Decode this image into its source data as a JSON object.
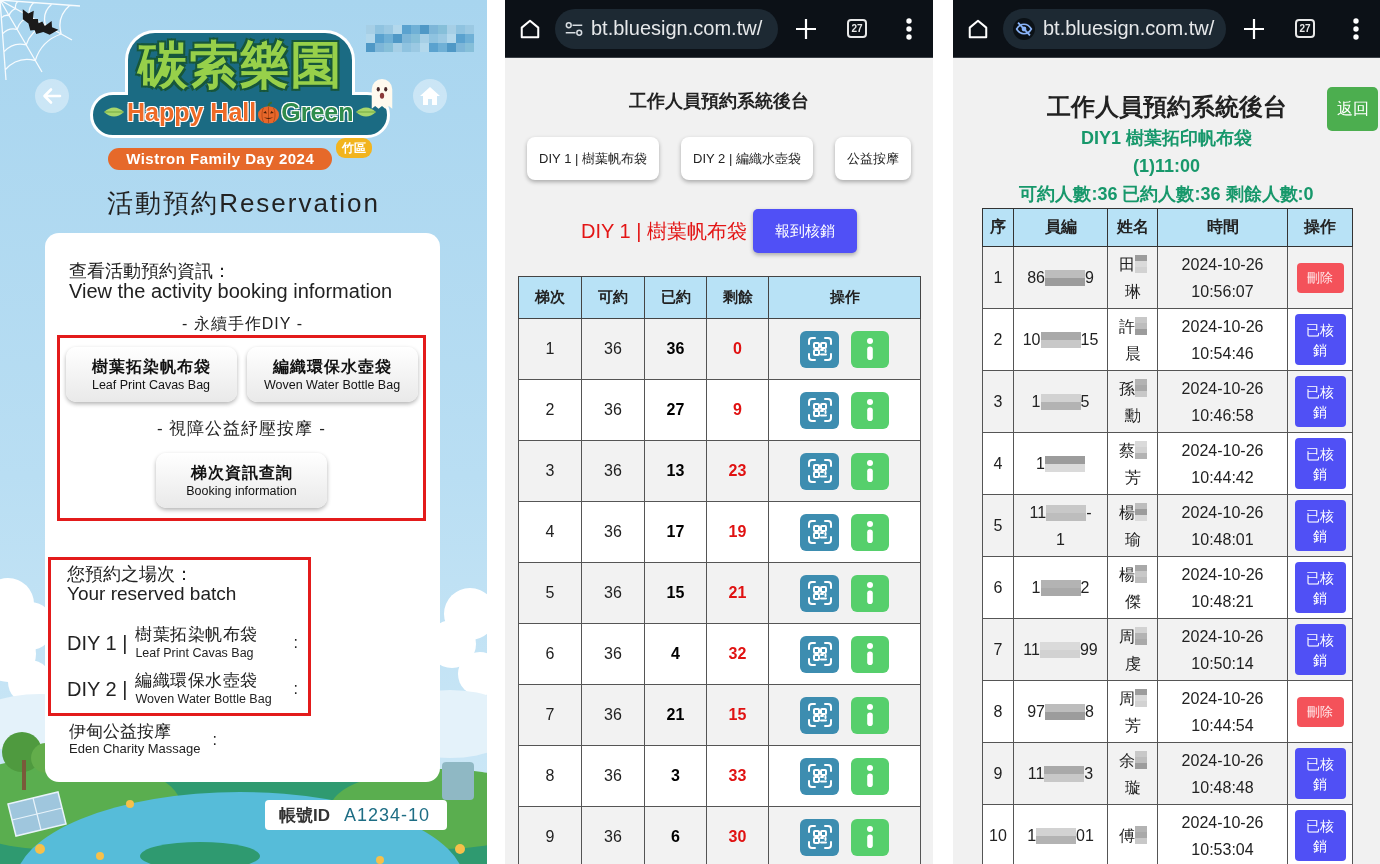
{
  "event_page": {
    "logo": {
      "title": "碳索樂園",
      "tagline_start": "Happy Hall",
      "tagline_end": "Green",
      "event": "Wistron Family Day 2024",
      "site": "竹區"
    },
    "title": "活動預約Reservation",
    "intro": [
      "查看活動預約資訊：",
      "View the activity booking information"
    ],
    "menu": {
      "heading": "- 永續手作DIY -",
      "highlighted": true,
      "groups": [
        {
          "buttons": [
            {
              "label": "樹葉拓染帆布袋",
              "sublabel": "Leaf Print Cavas Bag"
            },
            {
              "label": "編織環保水壺袋",
              "sublabel": "Woven Water Bottle Bag"
            }
          ]
        },
        {
          "heading": "- 視障公益紓壓按摩 -",
          "buttons": [
            {
              "label": "梯次資訊查詢",
              "sublabel": "Booking information"
            }
          ]
        }
      ]
    },
    "reserved": {
      "highlighted": true,
      "heading": [
        "您預約之場次：",
        "Your reserved batch"
      ],
      "items": [
        {
          "prefix": "DIY 1 |",
          "name": "樹葉拓染帆布袋",
          "name_en": "Leaf Print Cavas Bag",
          "value": ":"
        },
        {
          "prefix": "DIY 2 |",
          "name": "編織環保水壺袋",
          "name_en": "Woven Water Bottle Bag",
          "value": ":"
        }
      ]
    },
    "charity": {
      "name": "伊甸公益按摩",
      "name_en": "Eden Charity Massage",
      "value": ":"
    },
    "account": {
      "label": "帳號ID",
      "value": "A1234-10"
    }
  },
  "admin_page": {
    "browser": {
      "site_icon": {
        "kind": "tune"
      },
      "url": "bt.bluesign.com.tw/",
      "tab_count": "27"
    },
    "title": "工作人員預約系統後台",
    "activity_buttons": [
      "DIY 1 | 樹葉帆布袋",
      "DIY 2 | 編織水壺袋",
      "公益按摩"
    ],
    "heading": "DIY 1 | 樹葉帆布袋",
    "checkin_button": "報到核銷",
    "table": {
      "columns": [
        "梯次",
        "可約",
        "已約",
        "剩餘",
        "操作"
      ],
      "rows": [
        {
          "batch": "1",
          "capacity": "36",
          "booked": "36",
          "remaining": "0"
        },
        {
          "batch": "2",
          "capacity": "36",
          "booked": "27",
          "remaining": "9"
        },
        {
          "batch": "3",
          "capacity": "36",
          "booked": "13",
          "remaining": "23"
        },
        {
          "batch": "4",
          "capacity": "36",
          "booked": "17",
          "remaining": "19"
        },
        {
          "batch": "5",
          "capacity": "36",
          "booked": "15",
          "remaining": "21"
        },
        {
          "batch": "6",
          "capacity": "36",
          "booked": "4",
          "remaining": "32"
        },
        {
          "batch": "7",
          "capacity": "36",
          "booked": "21",
          "remaining": "15"
        },
        {
          "batch": "8",
          "capacity": "36",
          "booked": "3",
          "remaining": "33"
        },
        {
          "batch": "9",
          "capacity": "36",
          "booked": "6",
          "remaining": "30"
        }
      ]
    }
  },
  "list_page": {
    "browser": {
      "site_icon": {
        "kind": "eye_slash"
      },
      "url": "bt.bluesign.com.tw/",
      "tab_count": "27"
    },
    "title": "工作人員預約系統後台",
    "back_button": "返回",
    "activity": "DIY1 樹葉拓印帆布袋",
    "session": "(1)11:00",
    "summary": "可約人數:36 已約人數:36 剩餘人數:0",
    "table": {
      "columns": [
        "序",
        "員編",
        "姓名",
        "時間",
        "操作"
      ],
      "rows": [
        {
          "no": "1",
          "id": {
            "start": "86",
            "end": "9"
          },
          "name": {
            "first": "田",
            "second": "琳"
          },
          "date": "2024-10-26",
          "time": "10:56:07",
          "action": {
            "kind": "delete",
            "label": "刪除"
          }
        },
        {
          "no": "2",
          "id": {
            "start": "10",
            "end": "15"
          },
          "name": {
            "first": "許",
            "second": "晨"
          },
          "date": "2024-10-26",
          "time": "10:54:46",
          "action": {
            "kind": "verified",
            "label": "已核銷"
          }
        },
        {
          "no": "3",
          "id": {
            "start": "1",
            "end": "5"
          },
          "name": {
            "first": "孫",
            "second": "勳"
          },
          "date": "2024-10-26",
          "time": "10:46:58",
          "action": {
            "kind": "verified",
            "label": "已核銷"
          }
        },
        {
          "no": "4",
          "id": {
            "start": "1"
          },
          "name": {
            "first": "蔡",
            "second": "芳"
          },
          "date": "2024-10-26",
          "time": "10:44:42",
          "action": {
            "kind": "verified",
            "label": "已核銷"
          }
        },
        {
          "no": "5",
          "id": {
            "start": "11",
            "end": "-",
            "continued": "1"
          },
          "name": {
            "first": "楊",
            "second": "瑜"
          },
          "date": "2024-10-26",
          "time": "10:48:01",
          "action": {
            "kind": "verified",
            "label": "已核銷"
          }
        },
        {
          "no": "6",
          "id": {
            "start": "1",
            "end": "2"
          },
          "name": {
            "first": "楊",
            "second": "傑"
          },
          "date": "2024-10-26",
          "time": "10:48:21",
          "action": {
            "kind": "verified",
            "label": "已核銷"
          }
        },
        {
          "no": "7",
          "id": {
            "start": "11",
            "end": "99"
          },
          "name": {
            "first": "周",
            "second": "虔"
          },
          "date": "2024-10-26",
          "time": "10:50:14",
          "action": {
            "kind": "verified",
            "label": "已核銷"
          }
        },
        {
          "no": "8",
          "id": {
            "start": "97",
            "end": "8"
          },
          "name": {
            "first": "周",
            "second": "芳"
          },
          "date": "2024-10-26",
          "time": "10:44:54",
          "action": {
            "kind": "delete",
            "label": "刪除"
          }
        },
        {
          "no": "9",
          "id": {
            "start": "11",
            "end": "3"
          },
          "name": {
            "first": "余",
            "second": "璇"
          },
          "date": "2024-10-26",
          "time": "10:48:48",
          "action": {
            "kind": "verified",
            "label": "已核銷"
          }
        },
        {
          "no": "10",
          "id": {
            "start": "1",
            "end": "01"
          },
          "name": {
            "first": "傅"
          },
          "date": "2024-10-26",
          "time": "10:53:04",
          "action": {
            "kind": "verified",
            "label": "已核銷"
          }
        }
      ]
    }
  }
}
